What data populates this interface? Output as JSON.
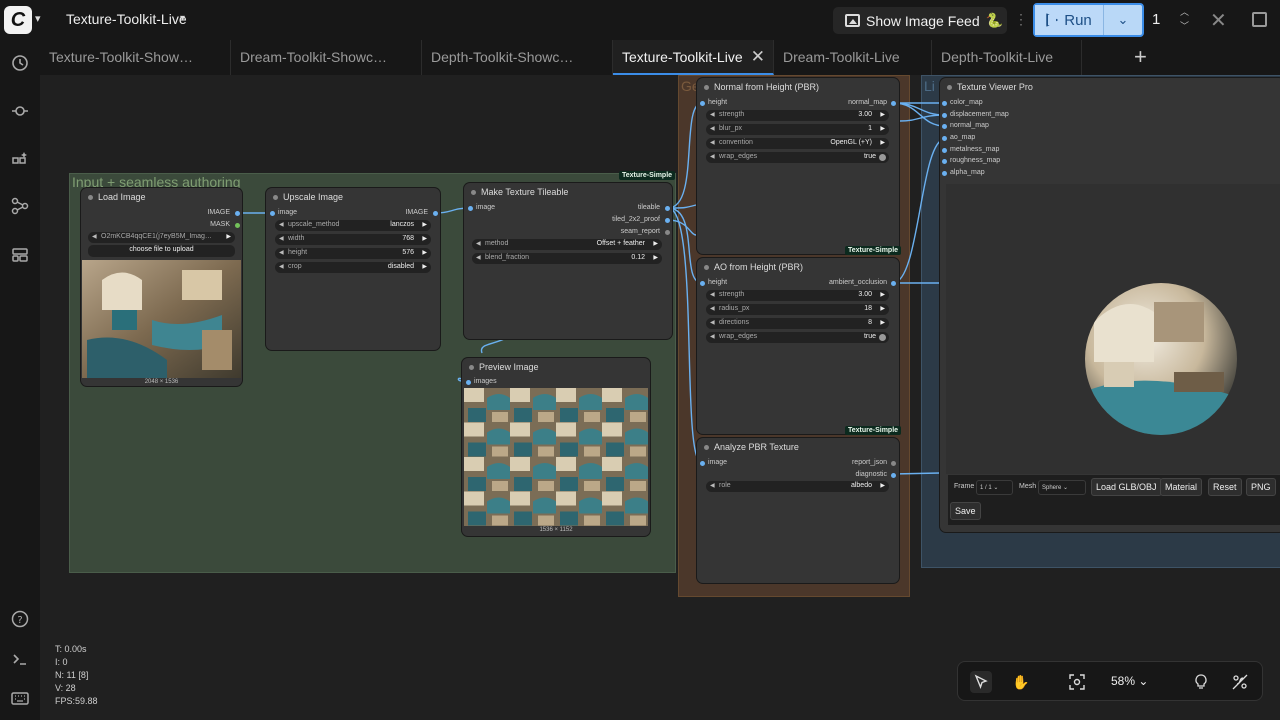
{
  "header": {
    "workflow_title": "Texture-Toolkit-Live",
    "image_feed_label": "Show Image Feed",
    "run_label": "Run",
    "queue_count": "1"
  },
  "tabs": [
    {
      "label": "Texture-Toolkit-Show…"
    },
    {
      "label": "Dream-Toolkit-Showc…"
    },
    {
      "label": "Depth-Toolkit-Showc…"
    },
    {
      "label": "Texture-Toolkit-Live",
      "active": true
    },
    {
      "label": "Dream-Toolkit-Live"
    },
    {
      "label": "Depth-Toolkit-Live"
    }
  ],
  "sidebar": [
    "history-icon",
    "nodes-icon",
    "model-library-icon",
    "workflows-icon",
    "templates-icon",
    "help-icon",
    "terminal-icon",
    "keyboard-icon"
  ],
  "groups": {
    "input": {
      "title": "Input + seamless authoring",
      "color": "#3b4a3b"
    },
    "ge": {
      "title": "Ge",
      "color": "#593d2a"
    },
    "live": {
      "title": "Li",
      "color": "#2c3a47"
    }
  },
  "nodes": {
    "load_image": {
      "title": "Load Image",
      "outputs": [
        "IMAGE",
        "MASK"
      ],
      "file_value": "O2mKCB4qqCE1(j7eyB5M_Imag…",
      "upload_label": "choose file to upload",
      "caption": "2048 × 1536"
    },
    "upscale": {
      "title": "Upscale Image",
      "input": "image",
      "output": "IMAGE",
      "widgets": [
        {
          "label": "upscale_method",
          "value": "lanczos"
        },
        {
          "label": "width",
          "value": "768"
        },
        {
          "label": "height",
          "value": "576"
        },
        {
          "label": "crop",
          "value": "disabled"
        }
      ]
    },
    "tileable": {
      "title": "Make Texture Tileable",
      "badge": "Texture-Simple",
      "input": "image",
      "outputs": [
        "tileable",
        "tiled_2x2_proof",
        "seam_report"
      ],
      "widgets": [
        {
          "label": "method",
          "value": "Offset + feather"
        },
        {
          "label": "blend_fraction",
          "value": "0.12"
        }
      ]
    },
    "preview": {
      "title": "Preview Image",
      "input": "images",
      "caption": "1536 × 1152"
    },
    "normal": {
      "title": "Normal from Height (PBR)",
      "badge": "Texture-Simple",
      "input": "height",
      "output": "normal_map",
      "widgets": [
        {
          "label": "strength",
          "value": "3.00"
        },
        {
          "label": "blur_px",
          "value": "1"
        },
        {
          "label": "convention",
          "value": "OpenGL (+Y)"
        },
        {
          "label": "wrap_edges",
          "value": "true"
        }
      ]
    },
    "ao": {
      "title": "AO from Height (PBR)",
      "badge": "Texture-Simple",
      "input": "height",
      "output": "ambient_occlusion",
      "widgets": [
        {
          "label": "strength",
          "value": "3.00"
        },
        {
          "label": "radius_px",
          "value": "18"
        },
        {
          "label": "directions",
          "value": "8"
        },
        {
          "label": "wrap_edges",
          "value": "true"
        }
      ]
    },
    "analyze": {
      "title": "Analyze PBR Texture",
      "input": "image",
      "outputs": [
        "report_json",
        "diagnostic"
      ],
      "widgets": [
        {
          "label": "role",
          "value": "albedo"
        }
      ]
    },
    "viewer": {
      "title": "Texture Viewer Pro",
      "inputs": [
        "color_map",
        "displacement_map",
        "normal_map",
        "ao_map",
        "metalness_map",
        "roughness_map",
        "alpha_map"
      ],
      "frame_label": "Frame",
      "frame_value": "1 / 1",
      "mesh_label": "Mesh",
      "mesh_value": "Sphere",
      "buttons": [
        "Load GLB/OBJ",
        "Material",
        "Reset",
        "PNG",
        "Save"
      ]
    }
  },
  "stats": [
    "T: 0.00s",
    "I: 0",
    "N: 11 [8]",
    "V: 28",
    "FPS:59.88"
  ],
  "zoom": "58%"
}
